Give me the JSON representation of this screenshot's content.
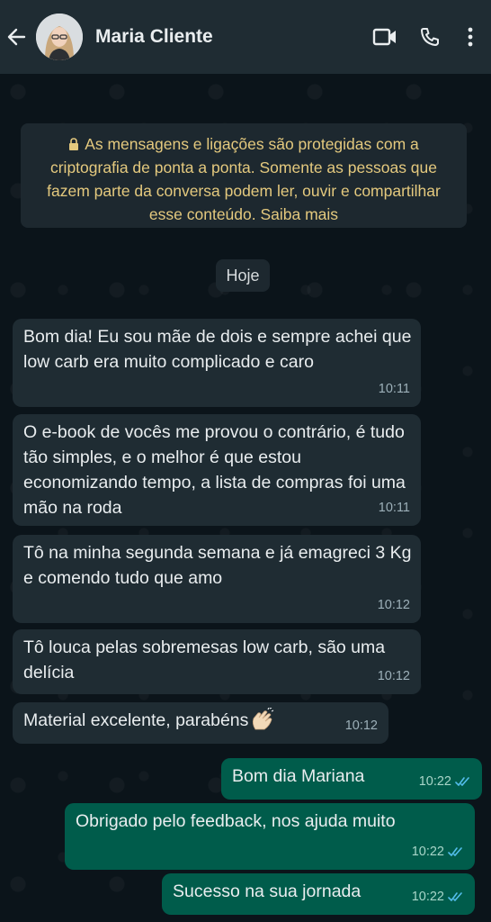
{
  "header": {
    "contact_name": "Maria Cliente"
  },
  "notice": {
    "text": "As mensagens e ligações são protegidas com a criptografia de ponta a ponta. Somente as pessoas que fazem parte da conversa podem ler, ouvir e compartilhar esse conteúdo. Saiba mais"
  },
  "date_chip": "Hoje",
  "messages": [
    {
      "direction": "in",
      "text": "Bom dia! Eu sou mãe de dois e sempre achei que low carb era muito complicado e caro",
      "time": "10:11"
    },
    {
      "direction": "in",
      "text": "O e-book de vocês me provou o contrário, é tudo tão simples, e o melhor é que estou economizando tempo, a lista de compras foi uma mão na roda",
      "time": "10:11"
    },
    {
      "direction": "in",
      "text": "Tô na minha segunda semana e já emagreci 3 Kg e comendo tudo que amo",
      "time": "10:12"
    },
    {
      "direction": "in",
      "text": "Tô louca pelas sobremesas low carb, são uma delícia",
      "time": "10:12"
    },
    {
      "direction": "in",
      "text": "Material excelente, parabéns",
      "time": "10:12",
      "emoji": "clapping-hands"
    },
    {
      "direction": "out",
      "text": "Bom dia Mariana",
      "time": "10:22",
      "status": "read"
    },
    {
      "direction": "out",
      "text": "Obrigado pelo feedback, nos ajuda muito",
      "time": "10:22",
      "status": "read"
    },
    {
      "direction": "out",
      "text": "Sucesso na sua jornada",
      "time": "10:22",
      "status": "read"
    }
  ],
  "icons": {
    "back": "arrow-left-icon",
    "video": "video-camera-icon",
    "call": "phone-icon",
    "menu": "kebab-menu-icon",
    "lock": "lock-icon",
    "read_ticks": "double-check-icon"
  },
  "colors": {
    "header_bg": "#1f2c33",
    "chat_bg": "#0b141a",
    "incoming_bubble": "#1f2c33",
    "outgoing_bubble": "#005c4b",
    "notice_text": "#e4c97e",
    "read_ticks": "#53bdeb"
  }
}
